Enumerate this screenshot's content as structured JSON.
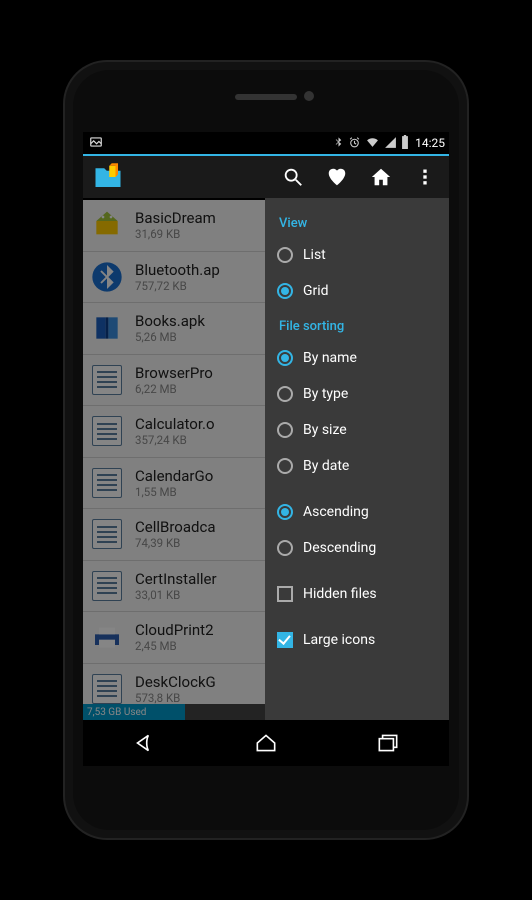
{
  "statusbar": {
    "time": "14:25"
  },
  "files": [
    {
      "name": "BasicDream",
      "size": "31,69 KB",
      "icon": "android"
    },
    {
      "name": "Bluetooth.ap",
      "size": "757,72 KB",
      "icon": "bluetooth"
    },
    {
      "name": "Books.apk",
      "size": "5,26 MB",
      "icon": "books"
    },
    {
      "name": "BrowserPro",
      "size": "6,22 MB",
      "icon": "doc"
    },
    {
      "name": "Calculator.o",
      "size": "357,24 KB",
      "icon": "doc"
    },
    {
      "name": "CalendarGo",
      "size": "1,55 MB",
      "icon": "doc"
    },
    {
      "name": "CellBroadca",
      "size": "74,39 KB",
      "icon": "doc"
    },
    {
      "name": "CertInstaller",
      "size": "33,01 KB",
      "icon": "doc"
    },
    {
      "name": "CloudPrint2",
      "size": "2,45 MB",
      "icon": "cloudprint"
    },
    {
      "name": "DeskClockG",
      "size": "573,8 KB",
      "icon": "doc"
    }
  ],
  "storage": {
    "used_label": "7,53 GB Used",
    "used_pct": 28
  },
  "menu": {
    "view_header": "View",
    "view": {
      "list": "List",
      "grid": "Grid",
      "selected": "grid"
    },
    "sort_header": "File sorting",
    "sort": {
      "by_name": "By name",
      "by_type": "By type",
      "by_size": "By size",
      "by_date": "By date",
      "selected": "by_name"
    },
    "order": {
      "asc": "Ascending",
      "desc": "Descending",
      "selected": "asc"
    },
    "hidden_files": {
      "label": "Hidden files",
      "checked": false
    },
    "large_icons": {
      "label": "Large icons",
      "checked": true
    }
  }
}
